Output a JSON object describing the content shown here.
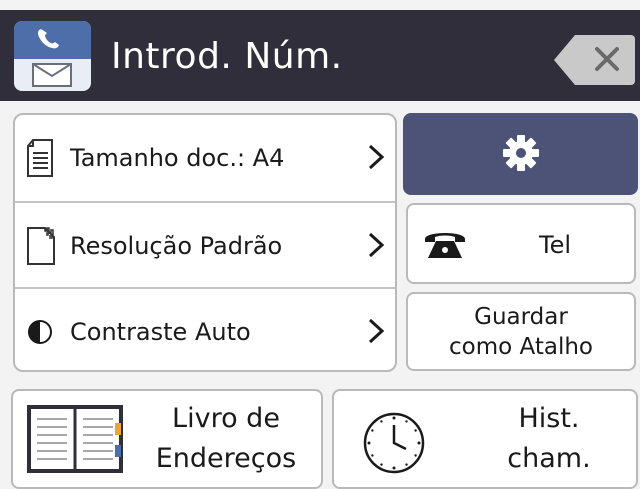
{
  "header": {
    "title": "Introd. Núm."
  },
  "settings": {
    "items": [
      {
        "label": "Tamanho doc.: A4",
        "icon": "document-icon"
      },
      {
        "label": "Resolução Padrão",
        "icon": "resolution-icon"
      },
      {
        "label": "Contraste Auto",
        "icon": "contrast-icon"
      }
    ]
  },
  "buttons": {
    "tel_label": "Tel",
    "shortcut_line1": "Guardar",
    "shortcut_line2": "como Atalho",
    "address_line1": "Livro de",
    "address_line2": "Endereços",
    "history_line1": "Hist.",
    "history_line2": "cham."
  },
  "colors": {
    "header_bg": "#2f2e3a",
    "settings_button_bg": "#4d5376",
    "fax_icon_blue": "#4d6ea8"
  }
}
